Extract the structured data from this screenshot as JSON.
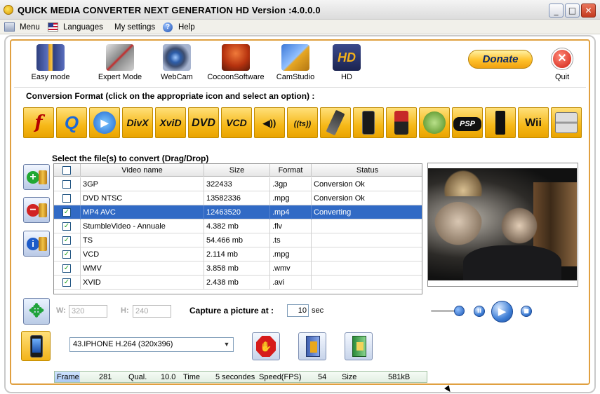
{
  "window": {
    "title": "QUICK MEDIA CONVERTER NEXT GENERATION HD Version :4.0.0.0",
    "controls": {
      "minimize": "_",
      "maximize": "□",
      "close": "✕"
    }
  },
  "menu": {
    "items": [
      {
        "label": "Menu",
        "icon": "menu-icon"
      },
      {
        "label": "Languages",
        "icon": "us-flag-icon"
      },
      {
        "label": "My settings",
        "icon": ""
      },
      {
        "label": "Help",
        "icon": "help-icon"
      }
    ]
  },
  "toolbar": {
    "buttons": [
      {
        "label": "Easy mode",
        "icon": "easy-mode-icon"
      },
      {
        "label": "Expert Mode",
        "icon": "expert-tools-icon"
      },
      {
        "label": "WebCam",
        "icon": "webcam-icon"
      },
      {
        "label": "CocoonSoftware",
        "icon": "cocoon-icon"
      },
      {
        "label": "CamStudio",
        "icon": "camstudio-icon"
      },
      {
        "label": "HD",
        "icon": "hd-icon"
      }
    ],
    "donate_label": "Donate",
    "quit_label": "Quit"
  },
  "conversion": {
    "title": "Conversion Format (click on the appropriate icon and select an option) :",
    "formats": [
      {
        "name": "flash",
        "label": "f"
      },
      {
        "name": "quicktime",
        "label": "Q"
      },
      {
        "name": "windows-media",
        "label": "▶"
      },
      {
        "name": "divx",
        "label": "DivX"
      },
      {
        "name": "xvid",
        "label": "XviD"
      },
      {
        "name": "dvd",
        "label": "DVD"
      },
      {
        "name": "vcd",
        "label": "VCD"
      },
      {
        "name": "audio",
        "label": "◀))"
      },
      {
        "name": "ts",
        "label": "((ts))"
      },
      {
        "name": "mobile-phone",
        "label": ""
      },
      {
        "name": "iphone",
        "label": ""
      },
      {
        "name": "ipod",
        "label": ""
      },
      {
        "name": "xbox",
        "label": ""
      },
      {
        "name": "psp",
        "label": "PSP"
      },
      {
        "name": "ps3",
        "label": ""
      },
      {
        "name": "wii",
        "label": "Wii"
      },
      {
        "name": "nintendo-ds",
        "label": ""
      }
    ]
  },
  "files": {
    "title": "Select the  file(s) to convert (Drag/Drop)",
    "columns": [
      "Video name",
      "Size",
      "Format",
      "Status"
    ],
    "rows": [
      {
        "name": "3GP",
        "size": "322433",
        "format": ".3gp",
        "status": "Conversion Ok",
        "checked": false,
        "selected": false
      },
      {
        "name": "DVD NTSC",
        "size": "13582336",
        "format": ".mpg",
        "status": "Conversion Ok",
        "checked": false,
        "selected": false
      },
      {
        "name": "MP4 AVC",
        "size": "12463520",
        "format": ".mp4",
        "status": "Converting",
        "checked": true,
        "selected": true
      },
      {
        "name": "StumbleVideo -  Annuale",
        "size": "4.382 mb",
        "format": ".flv",
        "status": "",
        "checked": true,
        "selected": false
      },
      {
        "name": "TS",
        "size": "54.466 mb",
        "format": ".ts",
        "status": "",
        "checked": true,
        "selected": false
      },
      {
        "name": "VCD",
        "size": "2.114 mb",
        "format": ".mpg",
        "status": "",
        "checked": true,
        "selected": false
      },
      {
        "name": "WMV",
        "size": "3.858 mb",
        "format": ".wmv",
        "status": "",
        "checked": true,
        "selected": false
      },
      {
        "name": "XVID",
        "size": "2.438 mb",
        "format": ".avi",
        "status": "",
        "checked": true,
        "selected": false
      }
    ]
  },
  "dimensions": {
    "w_label": "W:",
    "w_value": "320",
    "h_label": "H:",
    "h_value": "240"
  },
  "capture": {
    "label": "Capture a picture at :",
    "value": "10",
    "unit": "sec"
  },
  "player": {
    "volume": 0.85,
    "pause": "II",
    "play": "▶",
    "stop": "■"
  },
  "profile": {
    "selected": "43.IPHONE H.264 (320x396)"
  },
  "statusbar": {
    "frame_label": "Frame",
    "frame": "281",
    "qual_label": "Qual.",
    "qual": "10.0",
    "time_label": "Time",
    "time": "5 secondes",
    "speed_label": "Speed(FPS)",
    "speed": "54",
    "size_label": "Size",
    "size": "581kB"
  },
  "colors": {
    "accent": "#f6b818",
    "selection": "#316ac5",
    "frame_border": "#e0a040"
  }
}
